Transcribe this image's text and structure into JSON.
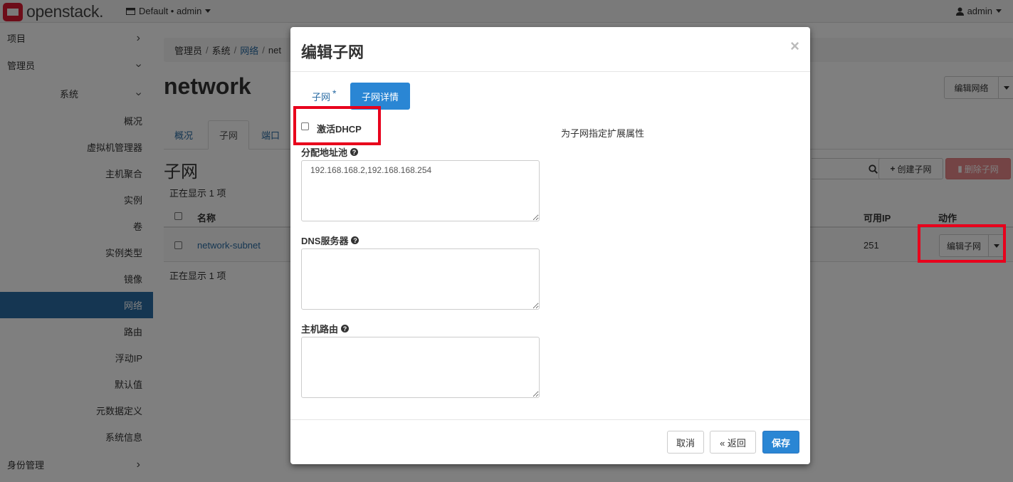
{
  "navbar": {
    "brand": "openstack.",
    "project": "Default • admin",
    "user": "admin"
  },
  "sidebar": {
    "items": [
      {
        "label": "项目"
      },
      {
        "label": "管理员"
      },
      {
        "label": "系统"
      },
      {
        "label": "概况"
      },
      {
        "label": "虚拟机管理器"
      },
      {
        "label": "主机聚合"
      },
      {
        "label": "实例"
      },
      {
        "label": "卷"
      },
      {
        "label": "实例类型"
      },
      {
        "label": "镜像"
      },
      {
        "label": "网络"
      },
      {
        "label": "路由"
      },
      {
        "label": "浮动IP"
      },
      {
        "label": "默认值"
      },
      {
        "label": "元数据定义"
      },
      {
        "label": "系统信息"
      },
      {
        "label": "身份管理"
      }
    ]
  },
  "breadcrumb": {
    "items": [
      "管理员",
      "系统",
      "网络",
      "net"
    ]
  },
  "page": {
    "title": "network",
    "edit_network_button": "编辑网络",
    "tabs": [
      "概况",
      "子网",
      "端口"
    ],
    "section_title": "子网",
    "count_text": "正在显示 1 项",
    "create_subnet_button": "创建子网",
    "delete_subnet_button": "删除子网",
    "columns": {
      "name": "名称",
      "available_ip": "可用IP",
      "actions": "动作"
    },
    "rows": [
      {
        "name": "network-subnet",
        "available_ip": "251",
        "action": "编辑子网"
      }
    ]
  },
  "modal": {
    "title": "编辑子网",
    "close": "×",
    "tabs": [
      {
        "label": "子网",
        "required_mark": "*"
      },
      {
        "label": "子网详情"
      }
    ],
    "dhcp_label": "激活DHCP",
    "help_text": "为子网指定扩展属性",
    "fields": [
      {
        "label": "分配地址池",
        "value": "192.168.168.2,192.168.168.254"
      },
      {
        "label": "DNS服务器",
        "value": ""
      },
      {
        "label": "主机路由",
        "value": ""
      }
    ],
    "buttons": {
      "cancel": "取消",
      "back": "« 返回",
      "save": "保存"
    }
  },
  "colors": {
    "primary": "#2a86d4",
    "link": "#2a6ca4",
    "danger": "#e8898a",
    "highlight": "#e8001c"
  }
}
